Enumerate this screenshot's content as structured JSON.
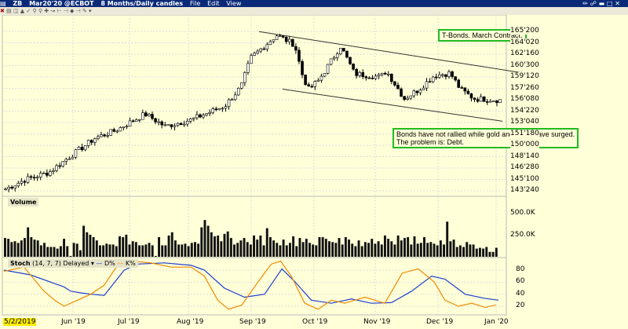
{
  "window": {
    "symbol": "ZB",
    "contract": "Mar20'20 @ECBOT",
    "timeframe": "8 Months/Daily candles",
    "menu": [
      "File",
      "Edit",
      "View"
    ],
    "toolbar_icons": [
      "close-icon",
      "text-icon",
      "bars-icon",
      "area-icon",
      "draw-icon",
      "zoom-in-icon",
      "zoom-out-icon",
      "crosshair-icon",
      "indicator-icon",
      "scroll-left-icon",
      "scroll-right-icon",
      "fit-icon",
      "split-icon",
      "link-icon"
    ]
  },
  "price_axis": [
    "165'200",
    "164'020",
    "162'160",
    "160'300",
    "159'120",
    "157'260",
    "156'080",
    "154'220",
    "153'040",
    "151'180",
    "150'000",
    "148'140",
    "146'280",
    "145'100",
    "143'240"
  ],
  "price_path": [
    [
      0,
      144.0
    ],
    [
      10,
      145.3
    ],
    [
      22,
      146.3
    ],
    [
      30,
      148.0
    ],
    [
      45,
      151.0
    ],
    [
      55,
      152.0
    ],
    [
      70,
      154.3
    ],
    [
      80,
      152.6
    ],
    [
      93,
      153.5
    ],
    [
      110,
      155.4
    ],
    [
      118,
      158.0
    ],
    [
      123,
      162.0
    ],
    [
      136,
      165.1
    ],
    [
      145,
      163.8
    ],
    [
      149,
      159.5
    ],
    [
      152,
      157.7
    ],
    [
      157,
      158.9
    ],
    [
      168,
      163.6
    ],
    [
      172,
      161.5
    ],
    [
      175,
      159.8
    ],
    [
      188,
      159.4
    ],
    [
      191,
      160.2
    ],
    [
      200,
      156.4
    ],
    [
      207,
      157.6
    ],
    [
      215,
      159.6
    ],
    [
      223,
      159.9
    ],
    [
      228,
      157.7
    ],
    [
      235,
      156.4
    ],
    [
      248,
      156.2
    ]
  ],
  "annotations": {
    "title_note": "T-Bonds. March Contract.",
    "comment_line1": "Bonds have not rallied while gold and silver have surged.",
    "comment_line2": "The problem is: Debt."
  },
  "volume": {
    "title": "Volume",
    "axis": [
      "500.0K",
      "250.0K"
    ],
    "values": [
      230,
      220,
      180,
      190,
      170,
      200,
      230,
      360,
      240,
      210,
      200,
      140,
      170,
      120,
      120,
      120,
      100,
      130,
      220,
      130,
      10,
      170,
      160,
      80,
      380,
      300,
      270,
      240,
      200,
      140,
      140,
      160,
      150,
      150,
      130,
      250,
      240,
      270,
      150,
      190,
      180,
      140,
      140,
      150,
      170,
      140,
      10,
      240,
      140,
      140,
      260,
      300,
      200,
      150,
      150,
      160,
      130,
      170,
      180,
      160,
      360,
      450,
      380,
      300,
      250,
      260,
      190,
      280,
      310,
      230,
      150,
      170,
      200,
      230,
      180,
      150,
      260,
      210,
      260,
      140,
      350,
      240,
      200,
      170,
      140,
      210,
      140,
      170,
      250,
      130,
      230,
      180,
      220,
      170,
      150,
      140,
      240,
      240,
      220,
      190,
      180,
      170,
      230,
      150,
      240,
      210,
      160,
      130,
      200,
      130,
      180,
      170,
      220,
      160,
      190,
      150,
      260,
      220,
      190,
      150,
      260,
      200,
      230,
      240,
      150,
      250,
      160,
      170,
      240,
      170,
      180,
      160,
      140,
      200,
      150,
      430,
      190,
      210,
      120,
      140,
      120,
      180,
      150,
      150,
      100,
      110,
      100,
      120,
      60,
      60,
      110
    ]
  },
  "stoch": {
    "title": "Stoch",
    "params": "(14, 7, 7)",
    "mode": "Delayed",
    "d_label": "D%",
    "k_label": "K%",
    "axis": [
      "80",
      "60",
      "40",
      "20"
    ],
    "colors": {
      "d": "#1f3fd0",
      "k": "#f08a00"
    },
    "d_path": [
      [
        0,
        80
      ],
      [
        20,
        72
      ],
      [
        35,
        60
      ],
      [
        45,
        52
      ],
      [
        50,
        45
      ],
      [
        58,
        42
      ],
      [
        65,
        40
      ],
      [
        75,
        38
      ],
      [
        90,
        80
      ],
      [
        100,
        90
      ],
      [
        120,
        92
      ],
      [
        140,
        88
      ],
      [
        150,
        80
      ],
      [
        165,
        50
      ],
      [
        180,
        35
      ],
      [
        195,
        40
      ],
      [
        208,
        82
      ],
      [
        218,
        60
      ],
      [
        230,
        30
      ],
      [
        245,
        25
      ],
      [
        260,
        32
      ],
      [
        275,
        25
      ],
      [
        290,
        26
      ],
      [
        305,
        45
      ],
      [
        320,
        70
      ],
      [
        330,
        65
      ],
      [
        345,
        40
      ],
      [
        360,
        33
      ],
      [
        370,
        30
      ]
    ],
    "k_path": [
      [
        0,
        78
      ],
      [
        15,
        85
      ],
      [
        30,
        45
      ],
      [
        38,
        30
      ],
      [
        45,
        20
      ],
      [
        55,
        30
      ],
      [
        65,
        40
      ],
      [
        75,
        55
      ],
      [
        85,
        88
      ],
      [
        95,
        95
      ],
      [
        110,
        92
      ],
      [
        125,
        85
      ],
      [
        140,
        85
      ],
      [
        150,
        70
      ],
      [
        160,
        30
      ],
      [
        168,
        15
      ],
      [
        178,
        22
      ],
      [
        190,
        60
      ],
      [
        200,
        90
      ],
      [
        207,
        95
      ],
      [
        215,
        70
      ],
      [
        225,
        25
      ],
      [
        235,
        15
      ],
      [
        245,
        30
      ],
      [
        255,
        25
      ],
      [
        270,
        35
      ],
      [
        285,
        25
      ],
      [
        298,
        75
      ],
      [
        310,
        82
      ],
      [
        322,
        60
      ],
      [
        330,
        30
      ],
      [
        340,
        20
      ],
      [
        350,
        25
      ],
      [
        360,
        18
      ],
      [
        368,
        22
      ]
    ]
  },
  "date_axis": {
    "start": "5/2/2019",
    "labels": [
      "Jun '19",
      "Jul '19",
      "Aug '19",
      "Sep '19",
      "Oct '19",
      "Nov '19",
      "Dec '19",
      "Jan '20"
    ]
  }
}
